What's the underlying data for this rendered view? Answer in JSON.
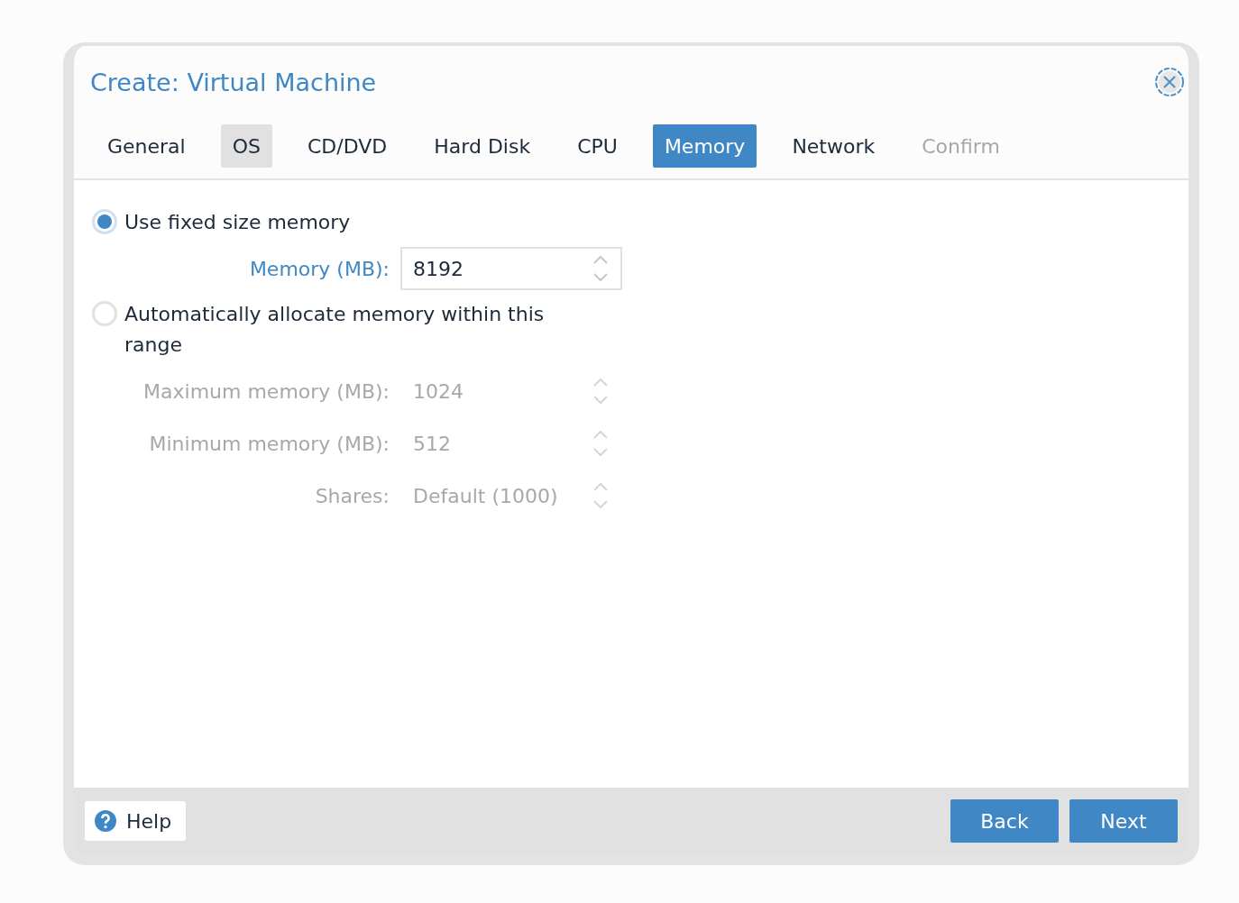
{
  "window": {
    "title": "Create: Virtual Machine"
  },
  "tabs": [
    {
      "label": "General",
      "selected": false,
      "hovered": false,
      "disabled": false
    },
    {
      "label": "OS",
      "selected": false,
      "hovered": true,
      "disabled": false
    },
    {
      "label": "CD/DVD",
      "selected": false,
      "hovered": false,
      "disabled": false
    },
    {
      "label": "Hard Disk",
      "selected": false,
      "hovered": false,
      "disabled": false
    },
    {
      "label": "CPU",
      "selected": false,
      "hovered": false,
      "disabled": false
    },
    {
      "label": "Memory",
      "selected": true,
      "hovered": false,
      "disabled": false
    },
    {
      "label": "Network",
      "selected": false,
      "hovered": false,
      "disabled": false
    },
    {
      "label": "Confirm",
      "selected": false,
      "hovered": false,
      "disabled": true
    }
  ],
  "options": [
    {
      "label": "Use fixed size memory",
      "selected": true,
      "fields": [
        {
          "label": "Memory (MB):",
          "value": "8192",
          "disabled": false
        }
      ]
    },
    {
      "label": "Automatically allocate memory within this range",
      "selected": false,
      "fields": [
        {
          "label": "Maximum memory (MB):",
          "value": "1024",
          "disabled": true
        },
        {
          "label": "Minimum memory (MB):",
          "value": "512",
          "disabled": true
        },
        {
          "label": "Shares:",
          "value": "Default (1000)",
          "disabled": true
        }
      ]
    }
  ],
  "footer": {
    "help": "Help",
    "buttons": [
      "Back",
      "Next"
    ]
  }
}
